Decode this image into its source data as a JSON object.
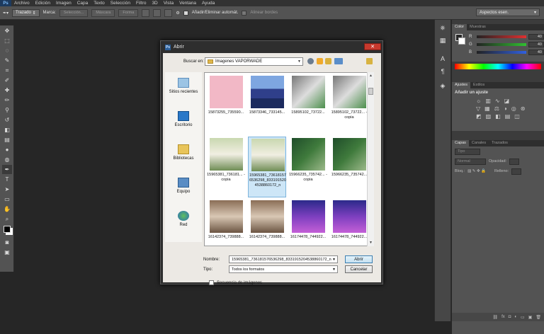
{
  "app": {
    "logo": "Ps"
  },
  "menu": [
    "Archivo",
    "Edición",
    "Imagen",
    "Capa",
    "Texto",
    "Selección",
    "Filtro",
    "3D",
    "Vista",
    "Ventana",
    "Ayuda"
  ],
  "options_bar": {
    "tool_preset": "Trazado",
    "marca_label": "Marca:",
    "seleccion_btn": "Selección...",
    "mascara_btn": "Máscara",
    "forma_btn": "Forma",
    "auto_add_label": "Añadir/Eliminar automát.",
    "align_edges_label": "Alinear bordes",
    "workspace": "Aspectos esen."
  },
  "panels": {
    "color_tabs": [
      "Color",
      "Muestras"
    ],
    "color_rows": [
      {
        "letter": "R",
        "value": "40",
        "color": "#e03030"
      },
      {
        "letter": "G",
        "value": "40",
        "color": "#30c030"
      },
      {
        "letter": "B",
        "value": "40",
        "color": "#3060e0"
      }
    ],
    "adjust_tabs": [
      "Ajustes",
      "Estilos"
    ],
    "adjust_title": "Añadir un ajuste",
    "layers_tabs": [
      "Capas",
      "Canales",
      "Trazados"
    ],
    "layers_kind": "Tipo",
    "blend_mode": "Normal",
    "opacity_label": "Opacidad:",
    "lock_label": "Bloq.:",
    "fill_label": "Relleno:"
  },
  "dialog": {
    "title": "Abrir",
    "close": "✕",
    "look_in_label": "Buscar en:",
    "look_in_value": "Imagenes VAPORWADE",
    "places": [
      "Sitios recientes",
      "Escritorio",
      "Bibliotecas",
      "Equipo",
      "Red"
    ],
    "files": [
      {
        "name": "15873255_735590..."
      },
      {
        "name": "15873346_733145..."
      },
      {
        "name": "15895102_73722..."
      },
      {
        "name": "15895102_73722... - copia"
      },
      {
        "name": "15965381_736181... - copia"
      },
      {
        "name": "15965381_736181576536298_8331915204538860172_n"
      },
      {
        "name": "15966235_735742... - copia"
      },
      {
        "name": "15966235_735742..."
      },
      {
        "name": "16142374_739888..."
      },
      {
        "name": "16142374_739888..."
      },
      {
        "name": "16174478_744922..."
      },
      {
        "name": "16174478_744922..."
      }
    ],
    "name_label": "Nombre:",
    "name_value": "15965381_736181576536298_8331915204538860172_n",
    "type_label": "Tipo:",
    "type_value": "Todos los formatos",
    "open_button": "Abrir",
    "cancel_button": "Cancelar",
    "sequence_label": "Secuencia de imágenes"
  }
}
